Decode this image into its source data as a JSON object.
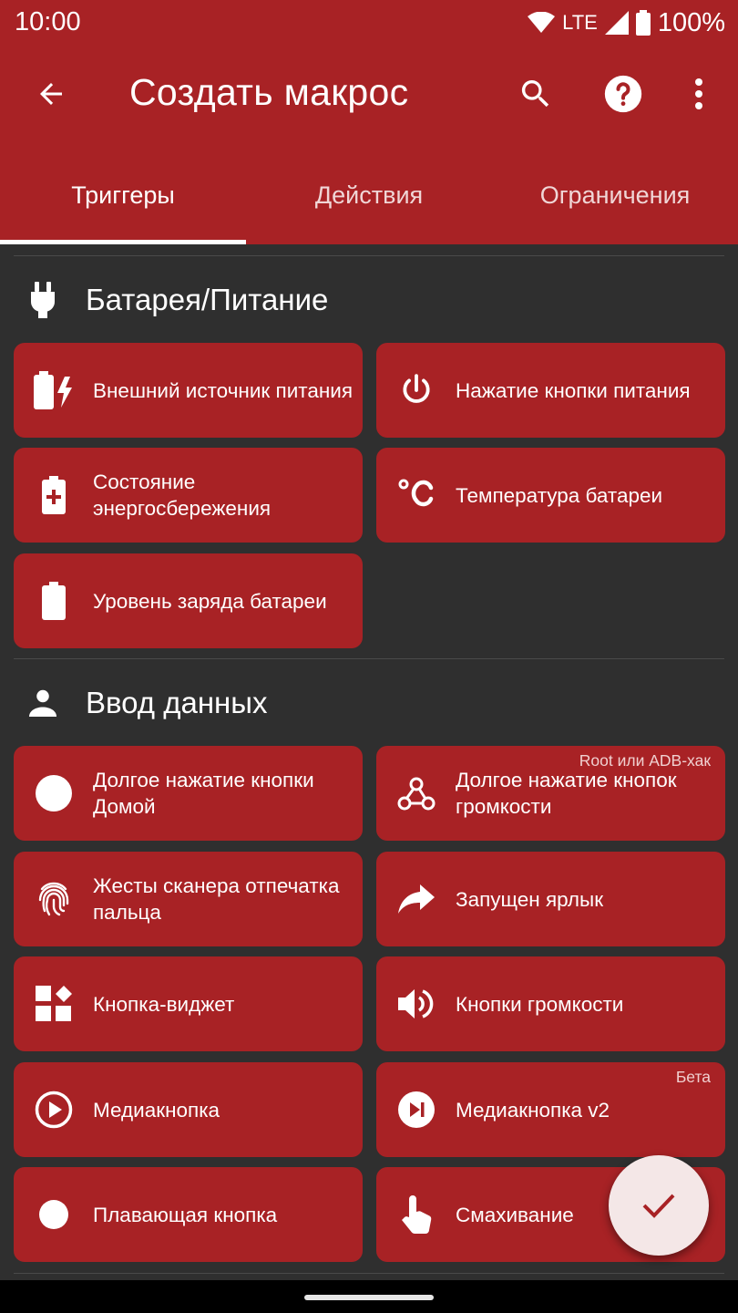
{
  "status": {
    "time": "10:00",
    "network": "LTE",
    "battery": "100%"
  },
  "toolbar": {
    "title": "Создать макрос"
  },
  "tabs": [
    {
      "label": "Триггеры"
    },
    {
      "label": "Действия"
    },
    {
      "label": "Ограничения"
    }
  ],
  "sections": [
    {
      "title": "Батарея/Питание",
      "icon": "power-plug-icon",
      "items": [
        {
          "label": "Внешний источник питания",
          "icon": "battery-charging-icon"
        },
        {
          "label": "Нажатие кнопки питания",
          "icon": "power-icon"
        },
        {
          "label": "Состояние энергосбережения",
          "icon": "battery-saver-icon"
        },
        {
          "label": "Температура батареи",
          "icon": "celsius-icon"
        },
        {
          "label": "Уровень заряда батареи",
          "icon": "battery-icon"
        }
      ]
    },
    {
      "title": "Ввод данных",
      "icon": "person-icon",
      "items": [
        {
          "label": "Долгое нажатие кнопки Домой",
          "icon": "circle-icon"
        },
        {
          "label": "Долгое нажатие кнопок громкости",
          "icon": "webhook-icon",
          "badge": "Root или ADB-хак"
        },
        {
          "label": "Жесты сканера отпечатка пальца",
          "icon": "fingerprint-icon"
        },
        {
          "label": "Запущен ярлык",
          "icon": "share-arrow-icon"
        },
        {
          "label": "Кнопка-виджет",
          "icon": "widgets-icon"
        },
        {
          "label": "Кнопки громкости",
          "icon": "volume-icon"
        },
        {
          "label": "Медиакнопка",
          "icon": "play-circle-icon"
        },
        {
          "label": "Медиакнопка v2",
          "icon": "skip-next-circle-icon",
          "badge": "Бета"
        },
        {
          "label": "Плавающая кнопка",
          "icon": "dot-icon"
        },
        {
          "label": "Смахивание",
          "icon": "touch-hand-icon"
        }
      ]
    }
  ],
  "colors": {
    "primary": "#a82225",
    "background": "#2f2f2f",
    "fab": "#f4e7e7"
  }
}
